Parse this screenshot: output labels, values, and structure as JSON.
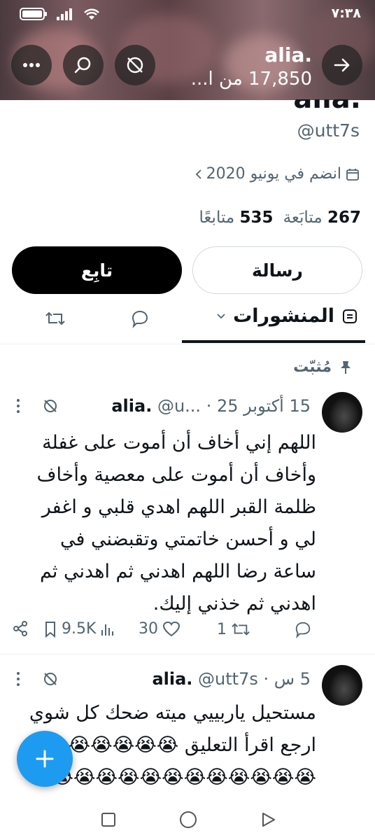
{
  "status_bar": {
    "time": "٧:٣٨"
  },
  "header": {
    "title": "alia.",
    "subtitle": "17,850 من ا..."
  },
  "profile": {
    "display_name": "alia.",
    "handle": "@utt7s",
    "joined": "انضم في يونيو 2020",
    "following_count": "535",
    "following_label": "متابعًا",
    "followers_count": "267",
    "followers_label": "متابَعة"
  },
  "buttons": {
    "message": "رسالة",
    "follow": "تابِع"
  },
  "tabs": {
    "posts": "المنشورات"
  },
  "pinned_label": "مُثبّت",
  "tweets": [
    {
      "name": "alia.",
      "handle": "@u...",
      "sep": "·",
      "time": "15 أكتوبر 25",
      "text": "اللهم إني أخاف أن أموت على غفلة وأخاف أن أموت على معصية وأخاف ظلمة القبر اللهم اهدي قلبي و اغفر لي و أحسن خاتمتي وتقبضني في ساعة رضا اللهم اهدني ثم اهدني ثم اهدني ثم خذني إليك.",
      "replies": "",
      "retweets": "1",
      "likes": "30",
      "views": "9.5K"
    },
    {
      "name": "alia.",
      "handle": "@utt7s",
      "sep": "·",
      "time": "5 س",
      "text": "مستحيل ياربييي ميته ضحك كل شوي ارجع اقرأ التعليق 😭😭😭😭😭😭😭😭😭😭😭😭😭😭😭😭😭😭😭"
    }
  ],
  "icons": {
    "back": "arrow-right-icon",
    "search": "search-icon",
    "more": "more-icon",
    "bookmark_slash": "no-notification-icon"
  },
  "colors": {
    "accent": "#1d9bf0",
    "text": "#0f1419",
    "muted": "#536471"
  }
}
